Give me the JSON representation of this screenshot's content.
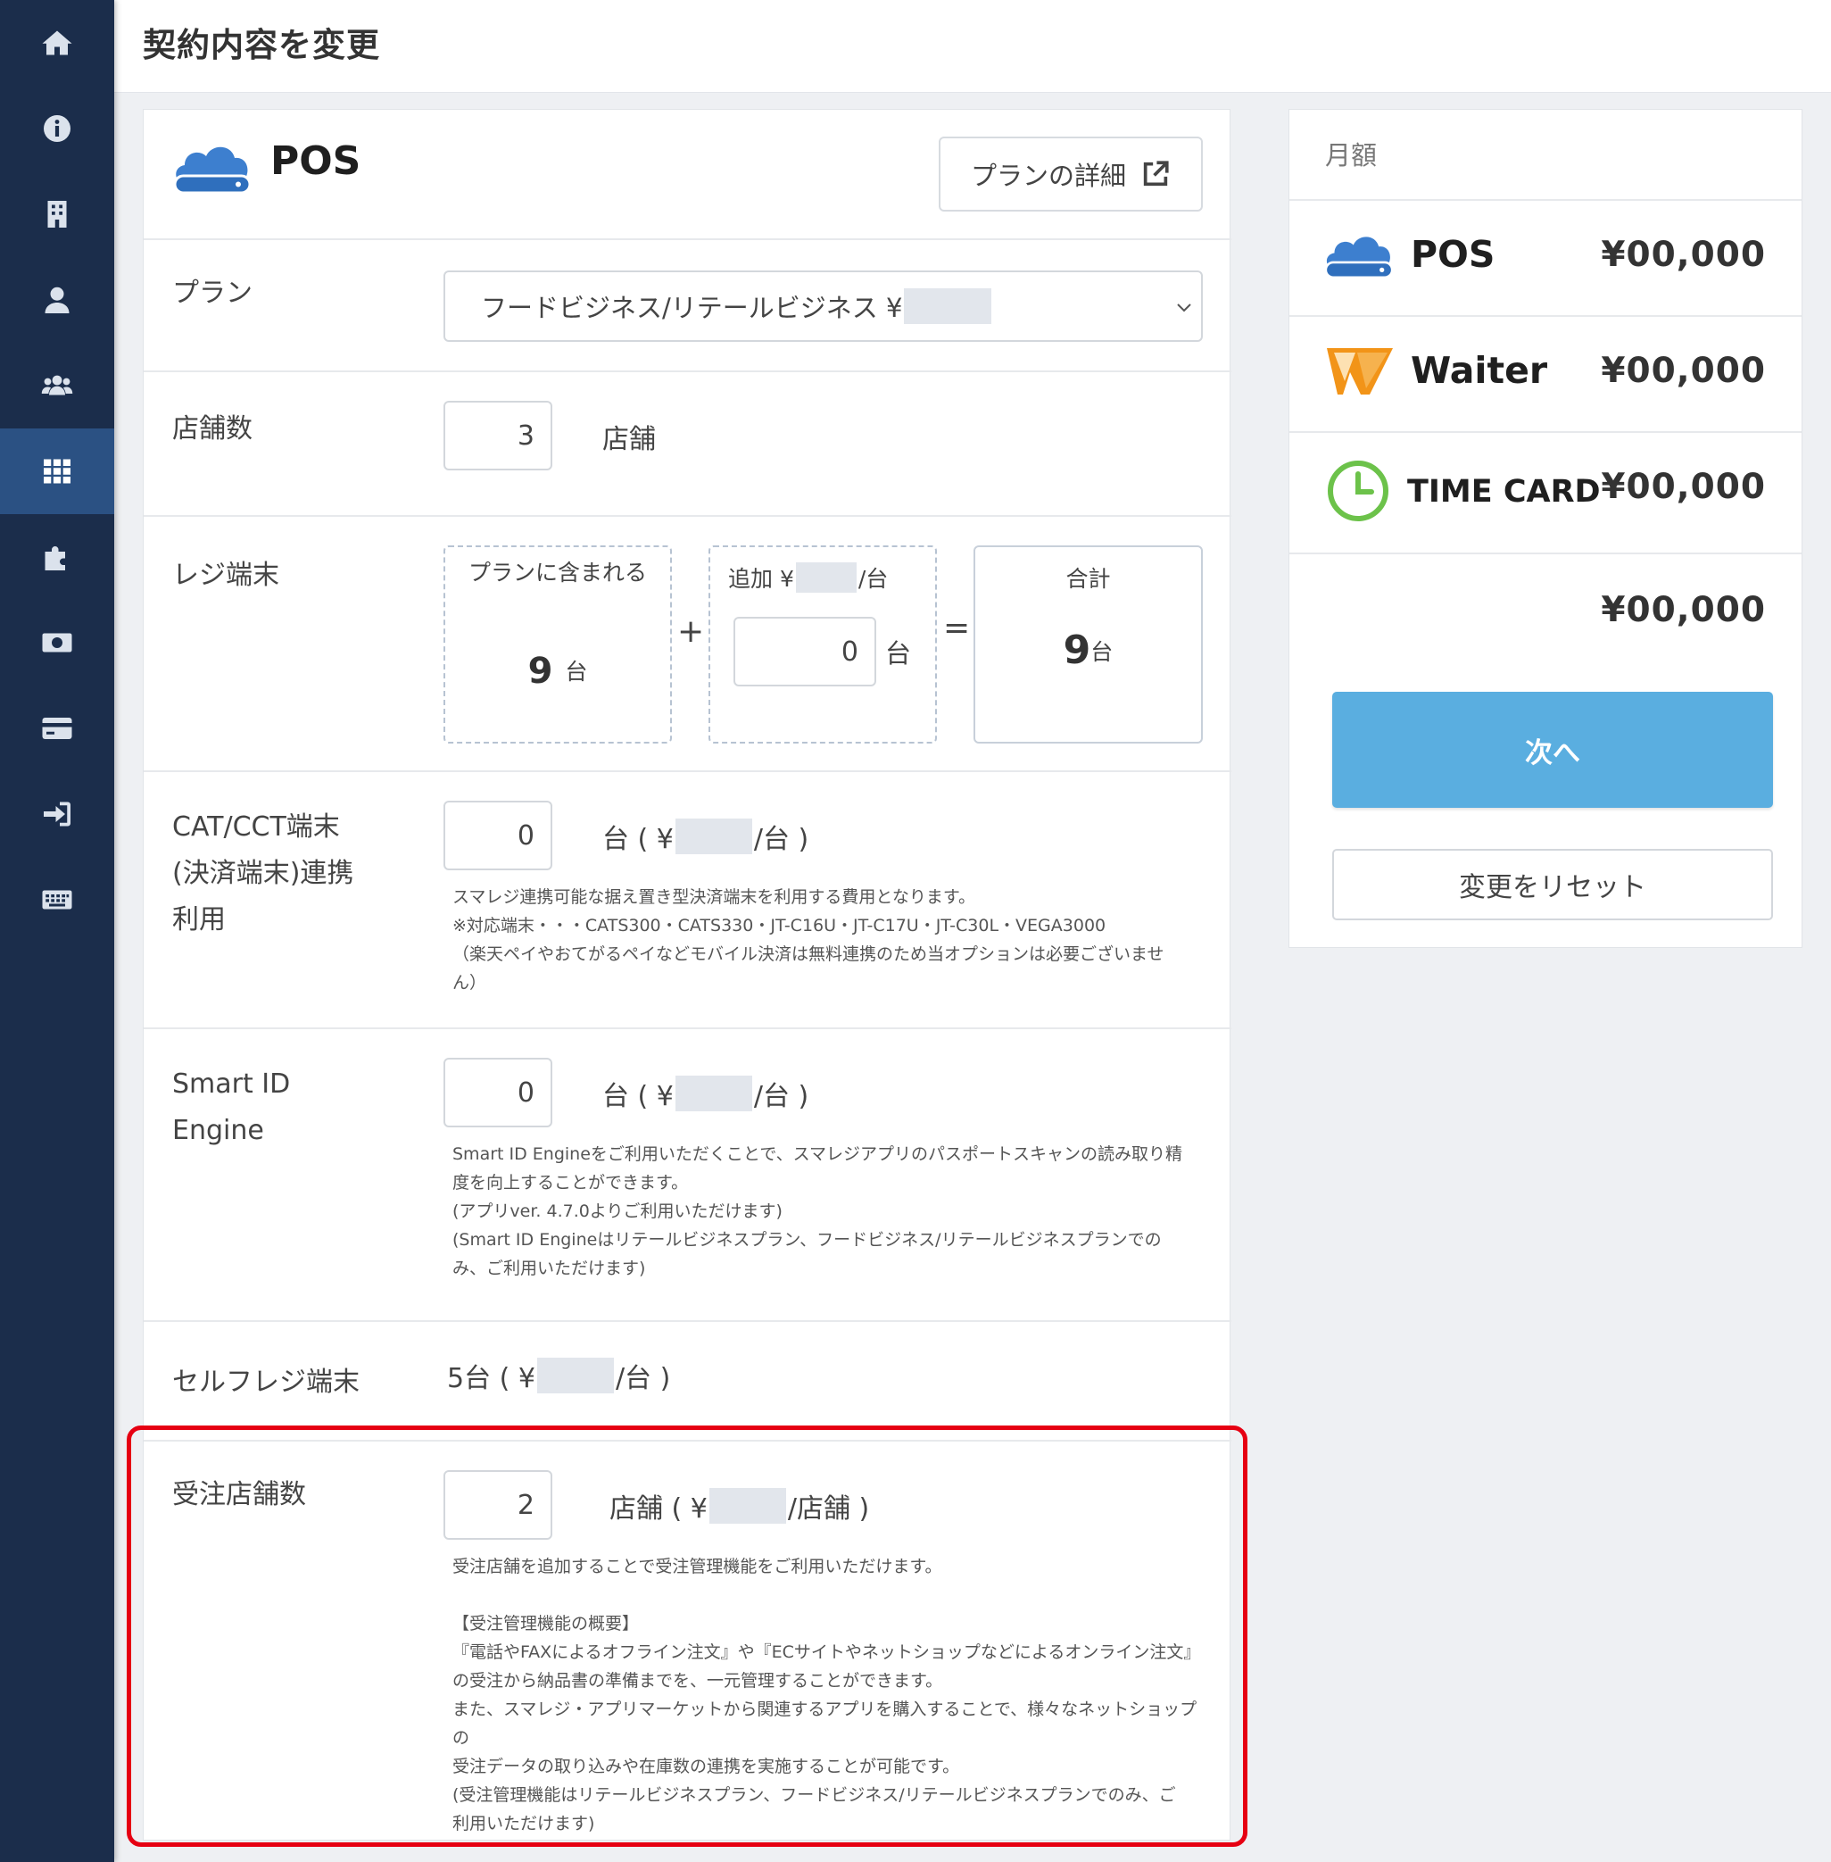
{
  "header": {
    "title": "契約内容を変更"
  },
  "sidebar": {
    "items": [
      {
        "icon": "home-icon"
      },
      {
        "icon": "info-icon"
      },
      {
        "icon": "building-icon"
      },
      {
        "icon": "user-icon"
      },
      {
        "icon": "users-icon"
      },
      {
        "icon": "grid-icon",
        "active": true
      },
      {
        "icon": "puzzle-icon"
      },
      {
        "icon": "money-icon"
      },
      {
        "icon": "credit-card-icon"
      },
      {
        "icon": "sign-in-icon"
      },
      {
        "icon": "keyboard-icon"
      }
    ]
  },
  "product": {
    "name": "POS",
    "detail_button": "プランの詳細"
  },
  "plan": {
    "label": "プラン",
    "selected": "フードビジネス/リテールビジネス ¥"
  },
  "stores": {
    "label": "店舗数",
    "value": "3",
    "unit": "店舗"
  },
  "registers": {
    "label": "レジ端末",
    "included_label": "プランに含まれる",
    "included_value": "9",
    "included_unit": "台",
    "plus": "+",
    "add_label_prefix": "追加 ¥",
    "add_label_suffix": "/台",
    "add_value": "0",
    "add_unit": "台",
    "equals": "=",
    "total_label": "合計",
    "total_value": "9",
    "total_unit": "台"
  },
  "cat": {
    "label_lines": [
      "CAT/CCT端末",
      "(決済端末)連携",
      "利用"
    ],
    "value": "0",
    "unit_prefix": "台 ( ¥",
    "unit_suffix": "/台 )",
    "notes": [
      "スマレジ連携可能な据え置き型決済端末を利用する費用となります。",
      "※対応端末・・・CATS300・CATS330・JT-C16U・JT-C17U・JT-C30L・VEGA3000",
      "（楽天ペイやおてがるペイなどモバイル決済は無料連携のため当オプションは必要ございませ",
      "ん）"
    ]
  },
  "smartid": {
    "label_lines": [
      "Smart ID",
      "Engine"
    ],
    "value": "0",
    "unit_prefix": "台 ( ¥",
    "unit_suffix": "/台 )",
    "notes": [
      "Smart ID Engineをご利用いただくことで、スマレジアプリのパスポートスキャンの読み取り精",
      "度を向上することができます。",
      "(アプリver. 4.7.0よりご利用いただけます)",
      "(Smart ID Engineはリテールビジネスプラン、フードビジネス/リテールビジネスプランでの",
      "み、ご利用いただけます)"
    ]
  },
  "selfreg": {
    "label": "セルフレジ端末",
    "value_prefix": "5台 ( ¥",
    "value_suffix": "/台 )"
  },
  "orders": {
    "label": "受注店舗数",
    "value": "2",
    "unit_prefix": "店舗 ( ¥",
    "unit_suffix": "/店舗 )",
    "notes": [
      "受注店舗を追加することで受注管理機能をご利用いただけます。",
      "",
      "【受注管理機能の概要】",
      "『電話やFAXによるオフライン注文』や『ECサイトやネットショップなどによるオンライン注文』",
      "の受注から納品書の準備までを、一元管理することができます。",
      "また、スマレジ・アプリマーケットから関連するアプリを購入することで、様々なネットショップの",
      "受注データの取り込みや在庫数の連携を実施することが可能です。",
      "(受注管理機能はリテールビジネスプラン、フードビジネス/リテールビジネスプランでのみ、ご",
      "利用いただけます)"
    ]
  },
  "summary": {
    "header": "月額",
    "items": [
      {
        "name": "POS",
        "price": "¥00,000"
      },
      {
        "name": "Waiter",
        "price": "¥00,000"
      },
      {
        "name": "TIME CARD",
        "price": "¥00,000"
      }
    ],
    "total": "¥00,000",
    "next_button": "次へ",
    "reset_button": "変更をリセット"
  },
  "colors": {
    "sidebar": "#1b2d4b",
    "sidebar_active": "#2b5183",
    "primary_button": "#5aaee0",
    "highlight": "#e60012",
    "pos_blue": "#3d7fcf",
    "waiter_orange": "#f29418",
    "timecard_green": "#6cc24a"
  }
}
